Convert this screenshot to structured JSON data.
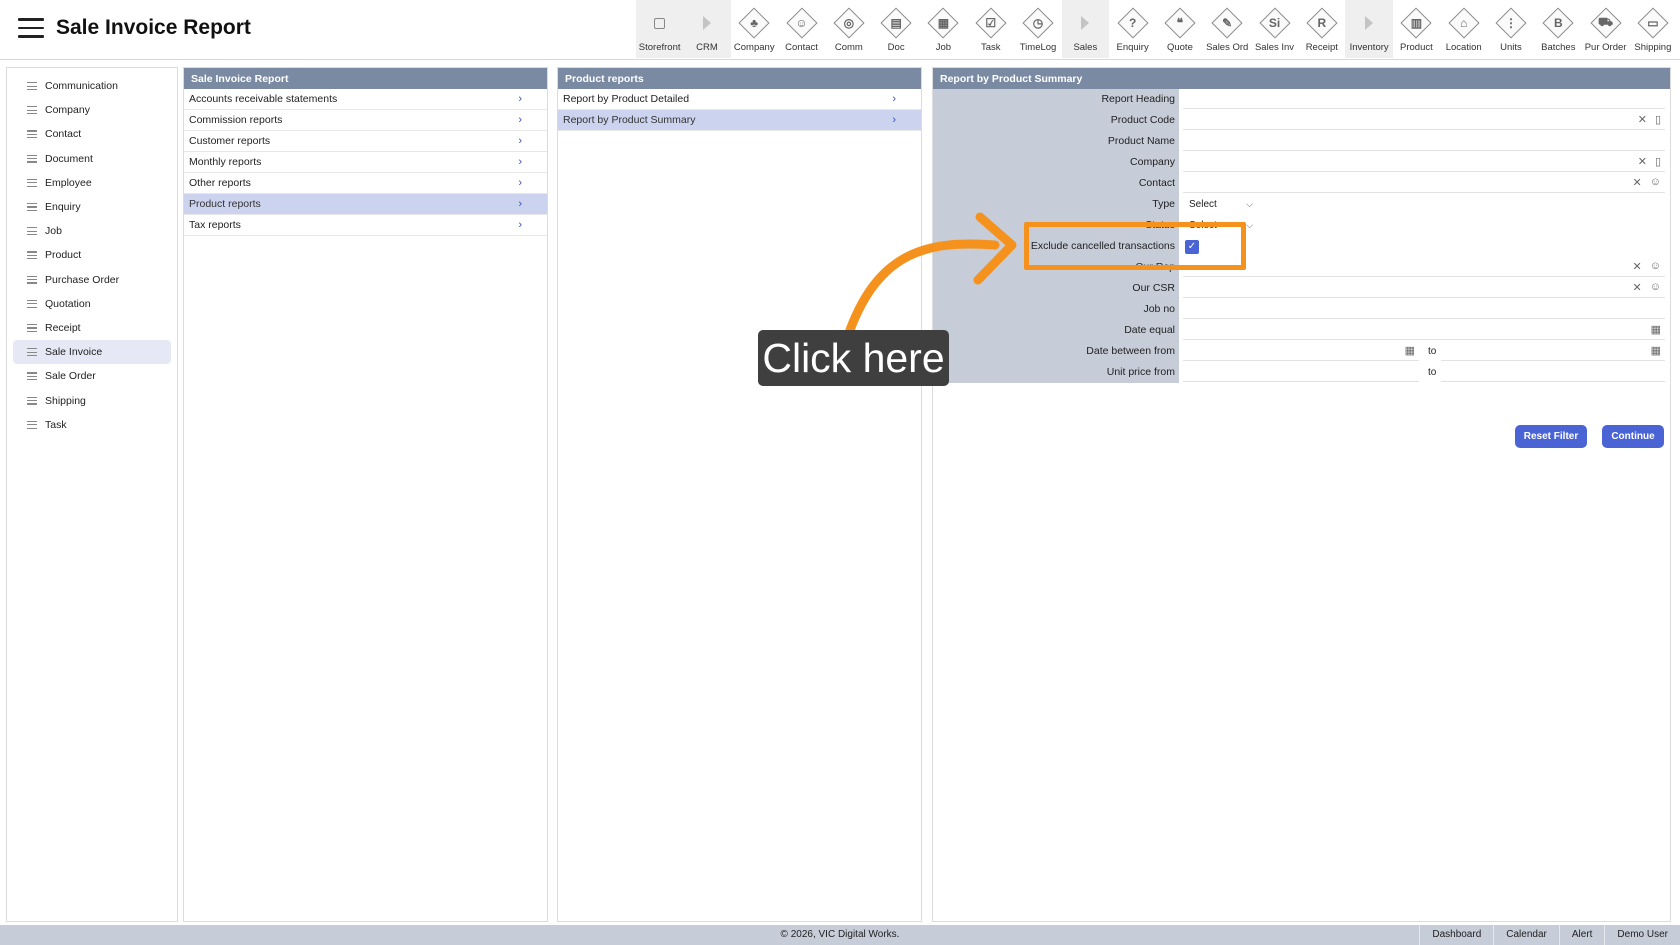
{
  "header": {
    "title": "Sale Invoice Report",
    "toolbar": [
      {
        "label": "Storefront",
        "icon": "external-link-icon",
        "kind": "ext"
      },
      {
        "label": "CRM",
        "icon": "arrow-right-icon",
        "kind": "arrow"
      },
      {
        "label": "Company",
        "icon": "company-icon",
        "glyph": "♣"
      },
      {
        "label": "Contact",
        "icon": "contact-icon",
        "glyph": "☺"
      },
      {
        "label": "Comm",
        "icon": "comm-icon",
        "glyph": "◎"
      },
      {
        "label": "Doc",
        "icon": "doc-icon",
        "glyph": "▤"
      },
      {
        "label": "Job",
        "icon": "job-icon",
        "glyph": "▦"
      },
      {
        "label": "Task",
        "icon": "task-icon",
        "glyph": "☑"
      },
      {
        "label": "TimeLog",
        "icon": "clock-icon",
        "glyph": "◷"
      },
      {
        "label": "Sales",
        "icon": "arrow-right-icon",
        "kind": "arrow"
      },
      {
        "label": "Enquiry",
        "icon": "enquiry-icon",
        "glyph": "?"
      },
      {
        "label": "Quote",
        "icon": "quote-icon",
        "glyph": "❝"
      },
      {
        "label": "Sales Ord",
        "icon": "sales-order-icon",
        "glyph": "✎"
      },
      {
        "label": "Sales Inv",
        "icon": "sales-invoice-icon",
        "glyph": "Si"
      },
      {
        "label": "Receipt",
        "icon": "receipt-icon",
        "glyph": "R"
      },
      {
        "label": "Inventory",
        "icon": "arrow-right-icon",
        "kind": "arrow"
      },
      {
        "label": "Product",
        "icon": "product-icon",
        "glyph": "▥"
      },
      {
        "label": "Location",
        "icon": "location-icon",
        "glyph": "⌂"
      },
      {
        "label": "Units",
        "icon": "units-icon",
        "glyph": "⋮"
      },
      {
        "label": "Batches",
        "icon": "batches-icon",
        "glyph": "B"
      },
      {
        "label": "Pur Order",
        "icon": "cart-icon",
        "glyph": "⛟"
      },
      {
        "label": "Shipping",
        "icon": "truck-icon",
        "glyph": "▭"
      }
    ]
  },
  "sidebar": {
    "items": [
      {
        "label": "Communication"
      },
      {
        "label": "Company"
      },
      {
        "label": "Contact"
      },
      {
        "label": "Document"
      },
      {
        "label": "Employee"
      },
      {
        "label": "Enquiry"
      },
      {
        "label": "Job"
      },
      {
        "label": "Product"
      },
      {
        "label": "Purchase Order"
      },
      {
        "label": "Quotation"
      },
      {
        "label": "Receipt"
      },
      {
        "label": "Sale Invoice",
        "active": true
      },
      {
        "label": "Sale Order"
      },
      {
        "label": "Shipping"
      },
      {
        "label": "Task"
      }
    ]
  },
  "panel1": {
    "title": "Sale Invoice Report",
    "items": [
      {
        "label": "Accounts receivable statements"
      },
      {
        "label": "Commission reports"
      },
      {
        "label": "Customer reports"
      },
      {
        "label": "Monthly reports"
      },
      {
        "label": "Other reports"
      },
      {
        "label": "Product reports",
        "active": true
      },
      {
        "label": "Tax reports"
      }
    ]
  },
  "panel2": {
    "title": "Product reports",
    "items": [
      {
        "label": "Report by Product Detailed"
      },
      {
        "label": "Report by Product Summary",
        "active": true
      }
    ]
  },
  "panel3": {
    "title": "Report by Product Summary",
    "fields": {
      "report_heading": {
        "label": "Report Heading",
        "value": ""
      },
      "product_code": {
        "label": "Product Code",
        "value": ""
      },
      "product_name": {
        "label": "Product Name",
        "value": ""
      },
      "company": {
        "label": "Company",
        "value": ""
      },
      "contact": {
        "label": "Contact",
        "value": ""
      },
      "type": {
        "label": "Type",
        "value": "Select"
      },
      "status": {
        "label": "Status",
        "value": "Select"
      },
      "exclude_cancelled": {
        "label": "Exclude cancelled transactions",
        "checked": true
      },
      "our_rep": {
        "label": "Our Rep",
        "value": ""
      },
      "our_csr": {
        "label": "Our CSR",
        "value": ""
      },
      "job_no": {
        "label": "Job no",
        "value": ""
      },
      "date_equal": {
        "label": "Date equal",
        "value": ""
      },
      "date_between": {
        "label": "Date between from",
        "to_label": "to",
        "from": "",
        "to": ""
      },
      "unit_price": {
        "label": "Unit price from",
        "to_label": "to",
        "from": "",
        "to": ""
      }
    },
    "buttons": {
      "reset": "Reset Filter",
      "continue": "Continue"
    }
  },
  "annotation": {
    "callout_text": "Click here",
    "color": "#f5921e"
  },
  "footer": {
    "copyright": "© 2026, VIC Digital Works.",
    "links": [
      "Dashboard",
      "Calendar",
      "Alert",
      "Demo User"
    ]
  },
  "colors": {
    "panel_header": "#7a8aa3",
    "accent": "#4a64d6",
    "active_row": "#ccd3ee",
    "form_label_bg": "#c6ccd8"
  }
}
